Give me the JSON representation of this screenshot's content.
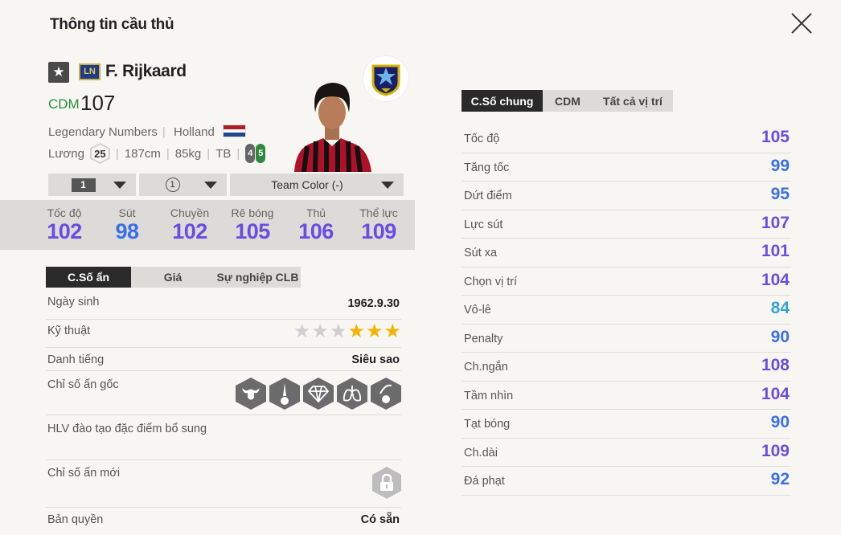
{
  "header": {
    "title": "Thông tin cầu thủ"
  },
  "player": {
    "name": "F. Rijkaard",
    "season_badge": "LN",
    "star_icon": "★",
    "position": "CDM",
    "overall": "107",
    "season": "Legendary Numbers",
    "nation": "Holland",
    "salary_label": "Lương",
    "salary": "25",
    "height": "187cm",
    "weight": "85kg",
    "body": "TB",
    "weak_foot": "4",
    "strong_foot": "5"
  },
  "selectors": {
    "level": "1",
    "enhance": "1",
    "team_color": "Team Color (-)"
  },
  "summary_stats": [
    {
      "label": "Tốc độ",
      "value": "102"
    },
    {
      "label": "Sút",
      "value": "98"
    },
    {
      "label": "Chuyền",
      "value": "102"
    },
    {
      "label": "Rê bóng",
      "value": "105"
    },
    {
      "label": "Thủ",
      "value": "106"
    },
    {
      "label": "Thể lực",
      "value": "109"
    }
  ],
  "left_tabs": [
    "C.Số ẩn",
    "Giá",
    "Sự nghiệp CLB"
  ],
  "info": {
    "birth_label": "Ngày sinh",
    "birth": "1962.9.30",
    "skill_label": "Kỹ thuật",
    "skill_stars": 3,
    "skill_max": 6,
    "rep_label": "Danh tiếng",
    "rep": "Siêu sao",
    "traits_label": "Chỉ số ẩn gốc",
    "trait_icons": [
      "buffalo-icon",
      "long-shot-icon",
      "diamond-icon",
      "lungs-icon",
      "finesse-icon"
    ],
    "coach_label": "HLV đào tạo đặc điểm bổ sung",
    "new_label": "Chỉ số ẩn mới",
    "copyright_label": "Bản quyền",
    "copyright": "Có sẵn"
  },
  "right_tabs": [
    "C.Số chung",
    "CDM",
    "Tất cả vị trí"
  ],
  "attributes": [
    {
      "label": "Tốc độ",
      "value": "105",
      "color": "#6a4ce0"
    },
    {
      "label": "Tăng tốc",
      "value": "99",
      "color": "#3c6fe6"
    },
    {
      "label": "Dứt điểm",
      "value": "95",
      "color": "#3c6fe6"
    },
    {
      "label": "Lực sút",
      "value": "107",
      "color": "#6a4ce0"
    },
    {
      "label": "Sút xa",
      "value": "101",
      "color": "#6a4ce0"
    },
    {
      "label": "Chọn vị trí",
      "value": "104",
      "color": "#6a4ce0"
    },
    {
      "label": "Vô-lê",
      "value": "84",
      "color": "#36a3d9"
    },
    {
      "label": "Penalty",
      "value": "90",
      "color": "#3c6fe6"
    },
    {
      "label": "Ch.ngắn",
      "value": "108",
      "color": "#6a4ce0"
    },
    {
      "label": "Tầm nhìn",
      "value": "104",
      "color": "#6a4ce0"
    },
    {
      "label": "Tạt bóng",
      "value": "90",
      "color": "#3c6fe6"
    },
    {
      "label": "Ch.dài",
      "value": "109",
      "color": "#6a4ce0"
    },
    {
      "label": "Đá phạt",
      "value": "92",
      "color": "#3c6fe6"
    }
  ]
}
